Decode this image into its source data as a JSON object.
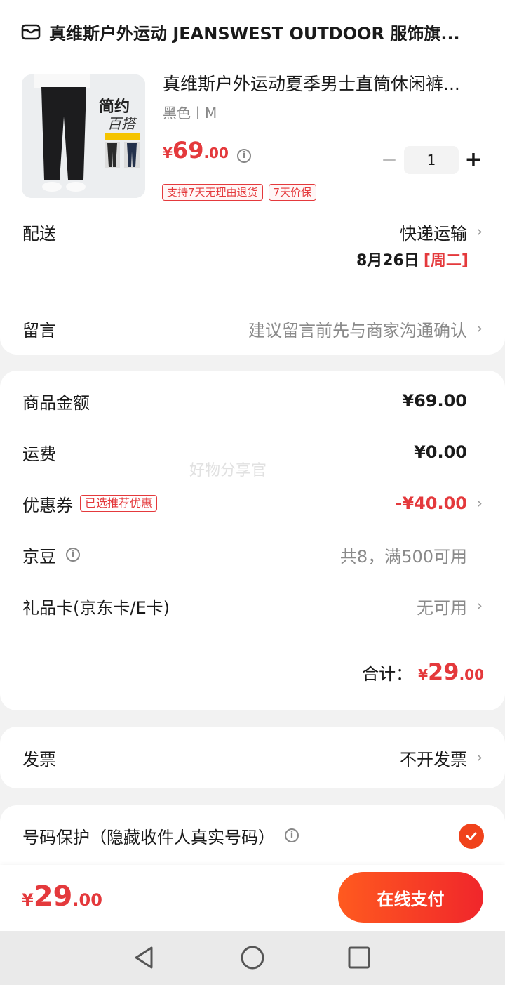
{
  "store": {
    "icon": "store-icon",
    "name": "真维斯户外运动 JEANSWEST OUTDOOR 服饰旗..."
  },
  "product": {
    "image_caption_main": "简约",
    "image_caption_sub": "百搭",
    "title": "真维斯户外运动夏季男士直筒休闲裤...",
    "spec": "黑色丨M",
    "price_symbol": "¥",
    "price_int": "69",
    "price_dec": ".00",
    "quantity": "1",
    "tags": [
      "支持7天无理由退货",
      "7天价保"
    ]
  },
  "delivery": {
    "label": "配送",
    "method": "快递运输",
    "date": "8月26日",
    "weekday": "[周二]"
  },
  "message": {
    "label": "留言",
    "placeholder": "建议留言前先与商家沟通确认"
  },
  "pricing": {
    "goods_label": "商品金额",
    "goods_value": "¥69.00",
    "shipping_label": "运费",
    "shipping_value": "¥0.00",
    "coupon_label": "优惠券",
    "coupon_badge": "已选推荐优惠",
    "coupon_value": "-¥40.00",
    "beans_label": "京豆",
    "beans_value": "共8，满500可用",
    "giftcard_label": "礼品卡(京东卡/E卡)",
    "giftcard_value": "无可用",
    "total_label": "合计：",
    "total_symbol": "¥",
    "total_int": "29",
    "total_dec": ".00",
    "watermark": "好物分享官"
  },
  "invoice": {
    "label": "发票",
    "value": "不开发票"
  },
  "privacy": {
    "label": "号码保护（隐藏收件人真实号码）",
    "checked": true
  },
  "footer": {
    "symbol": "¥",
    "total_int": "29",
    "total_dec": ".00",
    "pay_label": "在线支付"
  },
  "colors": {
    "accent": "#e4393c",
    "pay_gradient_start": "#ff5a1f",
    "pay_gradient_end": "#f0262b"
  }
}
